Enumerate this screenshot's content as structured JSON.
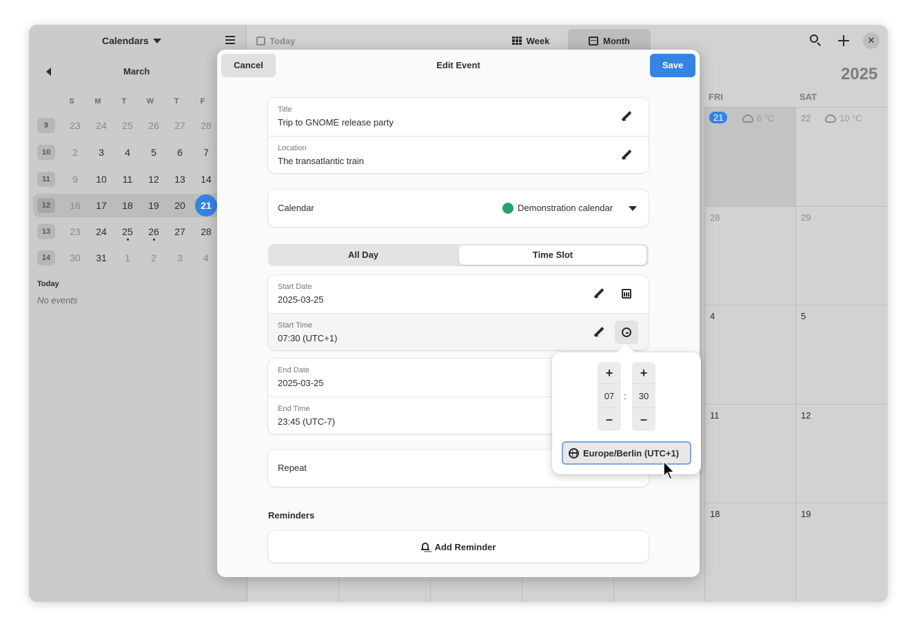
{
  "sidebar": {
    "calendars_label": "Calendars",
    "month": "March",
    "weekday_headers": [
      "S",
      "M",
      "T",
      "W",
      "T",
      "F"
    ],
    "weeks": [
      {
        "week": "9",
        "days": [
          {
            "d": "23",
            "muted": true
          },
          {
            "d": "24",
            "muted": true
          },
          {
            "d": "25",
            "muted": true
          },
          {
            "d": "26",
            "muted": true
          },
          {
            "d": "27",
            "muted": true
          },
          {
            "d": "28",
            "muted": true
          }
        ]
      },
      {
        "week": "10",
        "days": [
          {
            "d": "2",
            "muted": true
          },
          {
            "d": "3"
          },
          {
            "d": "4"
          },
          {
            "d": "5"
          },
          {
            "d": "6"
          },
          {
            "d": "7"
          }
        ]
      },
      {
        "week": "11",
        "days": [
          {
            "d": "9",
            "muted": true
          },
          {
            "d": "10"
          },
          {
            "d": "11"
          },
          {
            "d": "12"
          },
          {
            "d": "13"
          },
          {
            "d": "14"
          }
        ]
      },
      {
        "week": "12",
        "days": [
          {
            "d": "16",
            "muted": true
          },
          {
            "d": "17"
          },
          {
            "d": "18"
          },
          {
            "d": "19"
          },
          {
            "d": "20"
          },
          {
            "d": "21",
            "today": true
          }
        ]
      },
      {
        "week": "13",
        "days": [
          {
            "d": "23",
            "muted": true
          },
          {
            "d": "24"
          },
          {
            "d": "25",
            "dot": true
          },
          {
            "d": "26",
            "dot": true
          },
          {
            "d": "27"
          },
          {
            "d": "28"
          }
        ]
      },
      {
        "week": "14",
        "days": [
          {
            "d": "30",
            "muted": true
          },
          {
            "d": "31"
          },
          {
            "d": "1",
            "muted": true
          },
          {
            "d": "2",
            "muted": true
          },
          {
            "d": "3",
            "muted": true
          },
          {
            "d": "4",
            "muted": true
          }
        ]
      }
    ],
    "today_heading": "Today",
    "no_events": "No events"
  },
  "header": {
    "today_label": "Today",
    "week_label": "Week",
    "month_label": "Month",
    "close_label": "✕"
  },
  "month_view": {
    "year": "2025",
    "columns": [
      "FRI",
      "SAT"
    ],
    "fri_today": "21",
    "fri_weather": "6 °C",
    "sat_first": "22",
    "sat_weather": "10 °C",
    "fri_dates": [
      "28",
      "4",
      "11",
      "18"
    ],
    "sat_dates": [
      "29",
      "5",
      "12",
      "19"
    ]
  },
  "dialog": {
    "title": "Edit Event",
    "cancel_label": "Cancel",
    "save_label": "Save",
    "title_label": "Title",
    "title_value": "Trip to GNOME release party",
    "location_label": "Location",
    "location_value": "The transatlantic train",
    "calendar_label": "Calendar",
    "calendar_value": "Demonstration calendar",
    "calendar_color": "#26a269",
    "all_day_label": "All Day",
    "time_slot_label": "Time Slot",
    "start_date_label": "Start Date",
    "start_date_value": "2025-03-25",
    "start_time_label": "Start Time",
    "start_time_value": "07:30 (UTC+1)",
    "end_date_label": "End Date",
    "end_date_value": "2025-03-25",
    "end_time_label": "End Time",
    "end_time_value": "23:45 (UTC-7)",
    "repeat_label": "Repeat",
    "reminders_heading": "Reminders",
    "add_reminder_label": "Add Reminder"
  },
  "time_popover": {
    "hour": "07",
    "minute": "30",
    "separator": ":",
    "plus": "+",
    "minus": "–",
    "timezone": "Europe/Berlin (UTC+1)"
  },
  "colors": {
    "accent": "#3584e4",
    "calendar": "#26a269"
  }
}
